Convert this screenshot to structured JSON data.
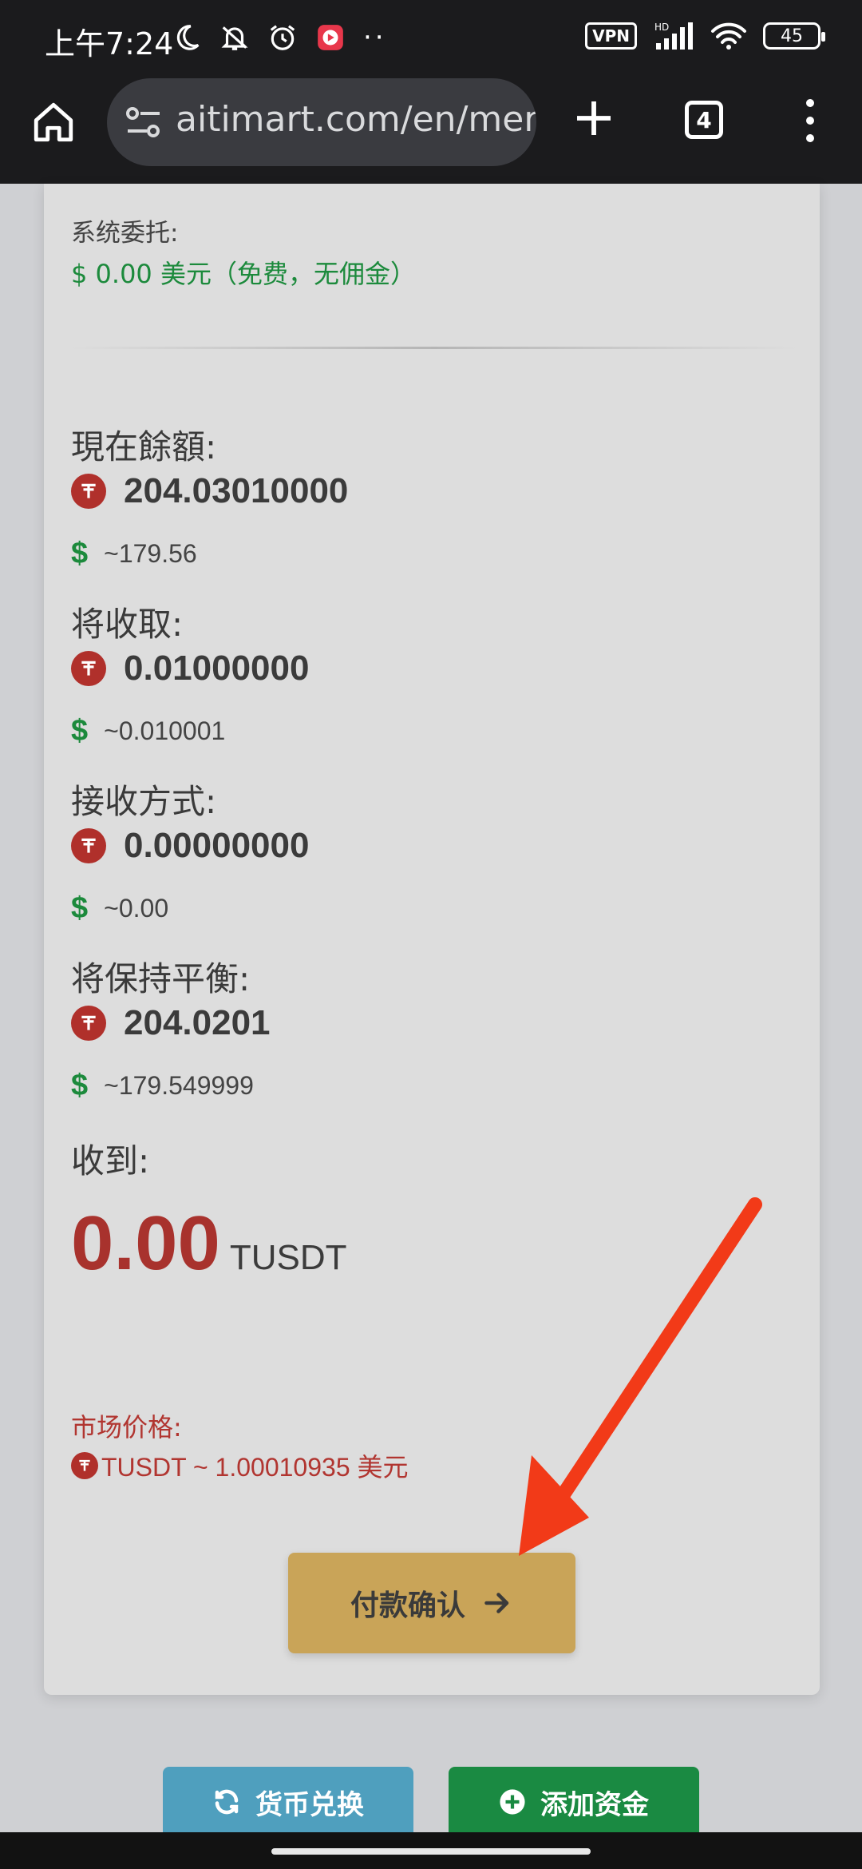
{
  "status_bar": {
    "time": "上午7:24",
    "vpn": "VPN",
    "network": "HD",
    "battery": "45",
    "overflow": "··",
    "icons": [
      "moon-icon",
      "bell-off-icon",
      "alarm-icon",
      "app-icon",
      "signal-icon",
      "wifi-icon"
    ]
  },
  "browser": {
    "url": "aitimart.com/en/mem",
    "tab_count": "4",
    "icons": [
      "home-icon",
      "site-settings-icon",
      "plus-icon",
      "menu-icon"
    ]
  },
  "card": {
    "system_commission": {
      "label": "系统委托:",
      "value": "$ 0.00 美元（免费，无佣金）"
    },
    "current_balance": {
      "label": "現在餘額:",
      "amount": "204.03010000",
      "usd_sign": "$",
      "usd": "~179.56"
    },
    "will_receive": {
      "label": "将收取:",
      "amount": "0.01000000",
      "usd_sign": "$",
      "usd": "~0.010001"
    },
    "method": {
      "label": "接收方式:",
      "amount": "0.00000000",
      "usd_sign": "$",
      "usd": "~0.00"
    },
    "remaining": {
      "label": "将保持平衡:",
      "amount": "204.0201",
      "usd_sign": "$",
      "usd": "~179.549999"
    },
    "received": {
      "label": "收到:",
      "amount": "0.00",
      "unit": "TUSDT"
    },
    "market_price": {
      "label": "市场价格:",
      "value": "TUSDT ~ 1.00010935 美元"
    },
    "confirm_button": "付款确认"
  },
  "bottom_actions": {
    "exchange": "货币兑换",
    "add_funds": "添加资金"
  },
  "colors": {
    "accent_gold": "#c9a458",
    "green": "#1c8a3c",
    "red": "#a8322d",
    "annotation_arrow": "#f23a18"
  }
}
